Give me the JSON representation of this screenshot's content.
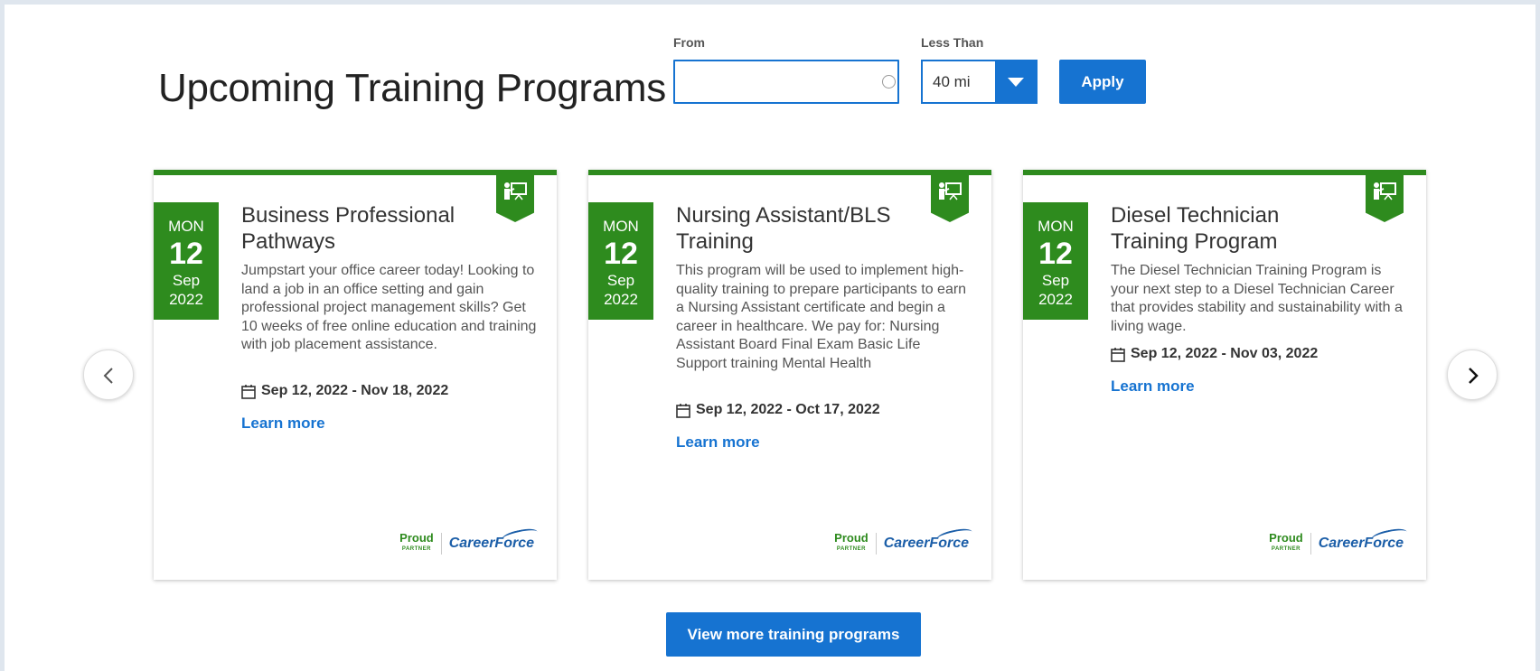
{
  "page_title": "Upcoming Training Programs",
  "filters": {
    "from_label": "From",
    "from_value": "",
    "less_than_label": "Less Than",
    "less_than_value": "40 mi",
    "apply_label": "Apply"
  },
  "programs": [
    {
      "dow": "MON",
      "day": "12",
      "month": "Sep",
      "year": "2022",
      "title": "Business Professional Pathways",
      "description": "Jumpstart your office career today! Looking to land a job in an office setting and gain professional project management skills? Get 10 weeks of free online education and training with job placement assistance.",
      "dates": "Sep 12, 2022 - Nov 18, 2022",
      "link": "Learn more"
    },
    {
      "dow": "MON",
      "day": "12",
      "month": "Sep",
      "year": "2022",
      "title": "Nursing Assistant/BLS Training",
      "description": "This program will be used to implement high-quality training to prepare participants to earn a Nursing Assistant certificate and begin a career in healthcare. We pay for:  Nursing Assistant Board Final Exam Basic Life Support training Mental Health",
      "dates": "Sep 12, 2022 - Oct 17, 2022",
      "link": "Learn more"
    },
    {
      "dow": "MON",
      "day": "12",
      "month": "Sep",
      "year": "2022",
      "title": "Diesel Technician Training Program",
      "description": "The Diesel Technician Training Program is your next step to a Diesel Technician Career that provides stability and sustainability with a living wage.",
      "dates": "Sep 12, 2022 - Nov 03, 2022",
      "link": "Learn more"
    }
  ],
  "partner": {
    "proud": "Proud",
    "partner": "PARTNER",
    "brand": "CareerForce"
  },
  "icons": {
    "prev": "chevron-left-icon",
    "next": "chevron-right-icon",
    "calendar": "calendar-icon",
    "training": "presenter-board-icon",
    "location": "location-circle-icon"
  },
  "colors": {
    "accent": "#1673d1",
    "brand_green": "#2e8b1e"
  },
  "view_more_label": "View more training programs"
}
